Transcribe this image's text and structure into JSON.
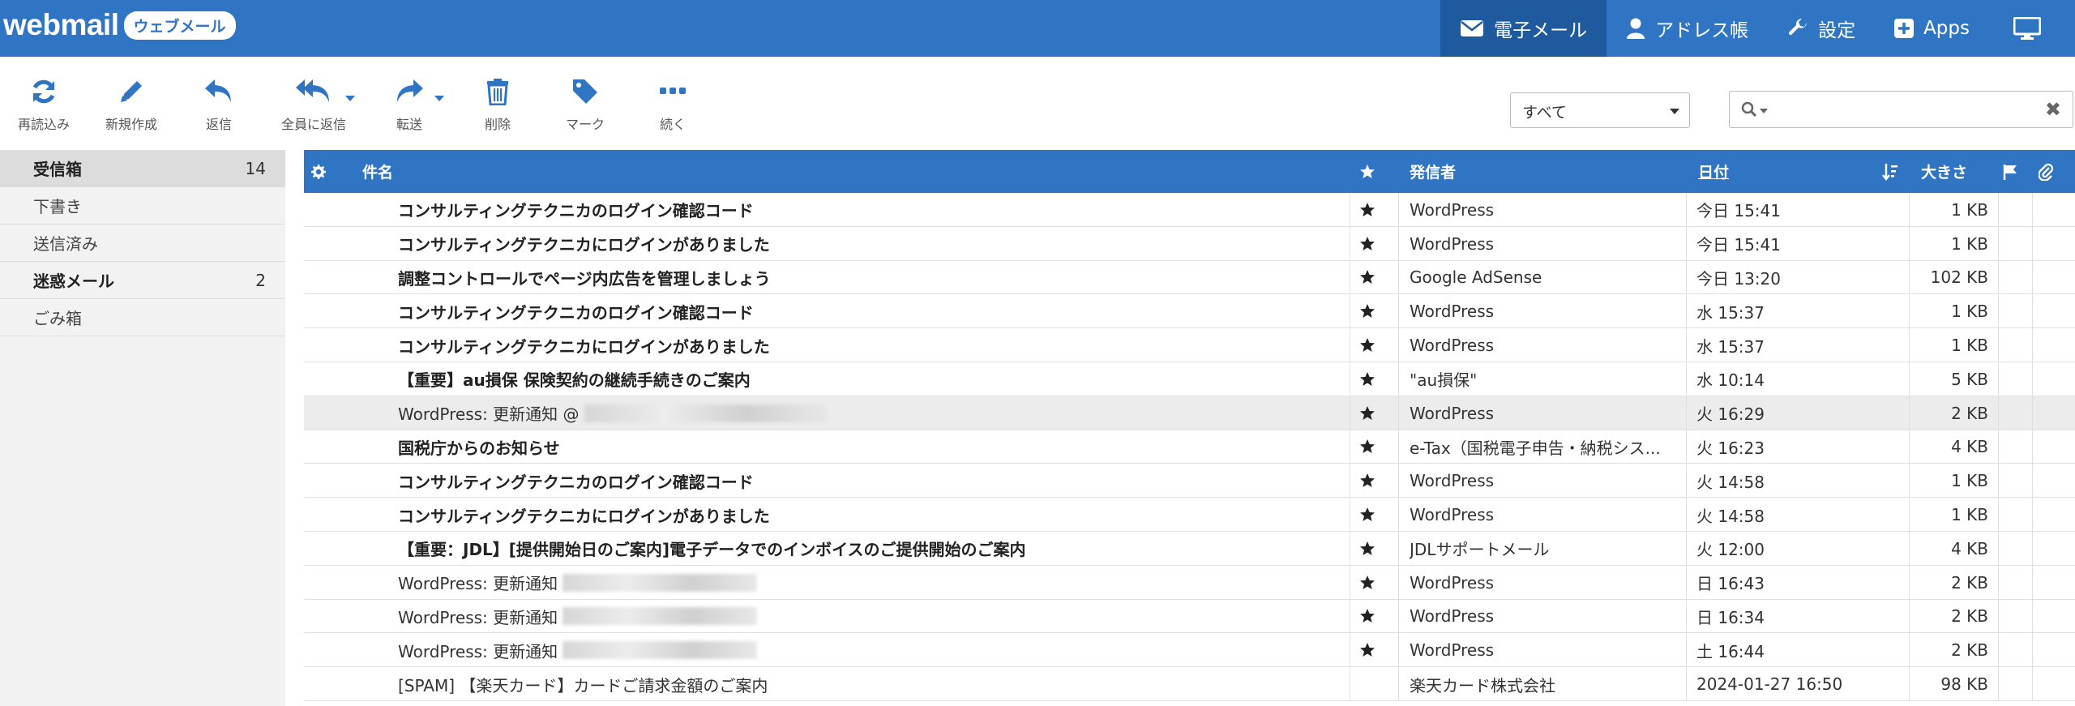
{
  "header": {
    "logo_text": "webmail",
    "logo_badge": "ウェブメール",
    "nav": [
      {
        "label": "電子メール",
        "icon": "envelope-icon",
        "active": true
      },
      {
        "label": "アドレス帳",
        "icon": "user-icon",
        "active": false
      },
      {
        "label": "設定",
        "icon": "wrench-icon",
        "active": false
      },
      {
        "label": "Apps",
        "icon": "plus-square-icon",
        "active": false
      }
    ]
  },
  "toolbar": {
    "reload": "再読込み",
    "compose": "新規作成",
    "reply": "返信",
    "reply_all": "全員に返信",
    "forward": "転送",
    "delete": "削除",
    "mark": "マーク",
    "more": "続く"
  },
  "filter": {
    "selected": "すべて"
  },
  "search": {
    "value": "",
    "clear_glyph": "✖"
  },
  "folders": [
    {
      "label": "受信箱",
      "count": "14",
      "bold": true,
      "selected": true
    },
    {
      "label": "下書き",
      "count": "",
      "bold": false,
      "selected": false
    },
    {
      "label": "送信済み",
      "count": "",
      "bold": false,
      "selected": false
    },
    {
      "label": "迷惑メール",
      "count": "2",
      "bold": true,
      "selected": false
    },
    {
      "label": "ごみ箱",
      "count": "",
      "bold": false,
      "selected": false
    }
  ],
  "list": {
    "headers": {
      "subject": "件名",
      "from": "発信者",
      "date": "日付",
      "size": "大きさ"
    },
    "rows": [
      {
        "subject": "コンサルティングテクニカのログイン確認コード",
        "from": "WordPress",
        "date": "今日 15:41",
        "size": "1 KB",
        "unread": true,
        "star": true,
        "redacted": false
      },
      {
        "subject": "コンサルティングテクニカにログインがありました",
        "from": "WordPress",
        "date": "今日 15:41",
        "size": "1 KB",
        "unread": true,
        "star": true,
        "redacted": false
      },
      {
        "subject": "調整コントロールでページ内広告を管理しましょう",
        "from": "Google AdSense",
        "date": "今日 13:20",
        "size": "102 KB",
        "unread": true,
        "star": true,
        "redacted": false
      },
      {
        "subject": "コンサルティングテクニカのログイン確認コード",
        "from": "WordPress",
        "date": "水 15:37",
        "size": "1 KB",
        "unread": true,
        "star": true,
        "redacted": false
      },
      {
        "subject": "コンサルティングテクニカにログインがありました",
        "from": "WordPress",
        "date": "水 15:37",
        "size": "1 KB",
        "unread": true,
        "star": true,
        "redacted": false
      },
      {
        "subject": "【重要】au損保 保険契約の継続手続きのご案内",
        "from": "\"au損保\"",
        "date": "水 10:14",
        "size": "5 KB",
        "unread": true,
        "star": true,
        "redacted": false
      },
      {
        "subject": "WordPress: 更新通知 @",
        "from": "WordPress",
        "date": "火 16:29",
        "size": "2 KB",
        "unread": false,
        "star": true,
        "redacted": true,
        "highlight": true
      },
      {
        "subject": "国税庁からのお知らせ",
        "from": "e-Tax（国税電子申告・納税シス...",
        "date": "火 16:23",
        "size": "4 KB",
        "unread": true,
        "star": true,
        "redacted": false
      },
      {
        "subject": "コンサルティングテクニカのログイン確認コード",
        "from": "WordPress",
        "date": "火 14:58",
        "size": "1 KB",
        "unread": true,
        "star": true,
        "redacted": false
      },
      {
        "subject": "コンサルティングテクニカにログインがありました",
        "from": "WordPress",
        "date": "火 14:58",
        "size": "1 KB",
        "unread": true,
        "star": true,
        "redacted": false
      },
      {
        "subject": "【重要：JDL】[提供開始日のご案内]電子データでのインボイスのご提供開始のご案内",
        "from": "JDLサポートメール",
        "date": "火 12:00",
        "size": "4 KB",
        "unread": true,
        "star": true,
        "redacted": false
      },
      {
        "subject": "WordPress: 更新通知",
        "from": "WordPress",
        "date": "日 16:43",
        "size": "2 KB",
        "unread": false,
        "star": true,
        "redacted": true
      },
      {
        "subject": "WordPress: 更新通知",
        "from": "WordPress",
        "date": "日 16:34",
        "size": "2 KB",
        "unread": false,
        "star": true,
        "redacted": true
      },
      {
        "subject": "WordPress: 更新通知",
        "from": "WordPress",
        "date": "土 16:44",
        "size": "2 KB",
        "unread": false,
        "star": true,
        "redacted": true
      },
      {
        "subject": "[SPAM] 【楽天カード】カードご請求金額のご案内",
        "from": "楽天カード株式会社",
        "date": "2024-01-27 16:50",
        "size": "98 KB",
        "unread": false,
        "star": false,
        "redacted": false
      }
    ]
  },
  "colors": {
    "accent": "#2f75c4",
    "accent_dark": "#1f5a9e"
  }
}
